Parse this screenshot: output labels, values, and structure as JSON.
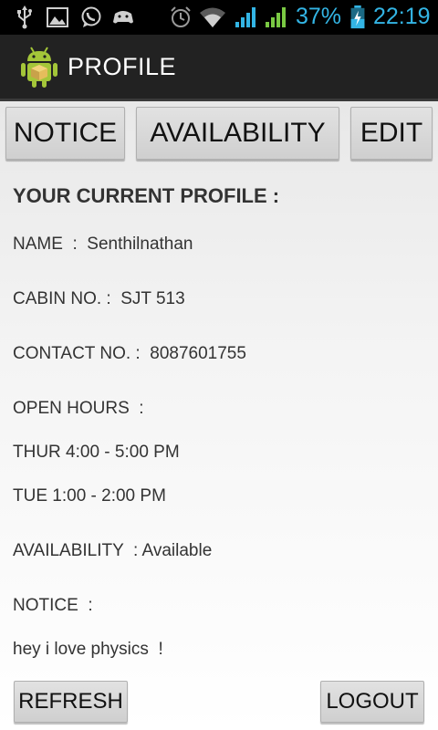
{
  "status_bar": {
    "battery_percent": "37%",
    "time": "22:19",
    "left_icons": [
      "usb-icon",
      "image-icon",
      "whatsapp-icon",
      "gamepad-icon"
    ],
    "right_icons": [
      "alarm-icon",
      "wifi-icon",
      "signal-icon",
      "signal-icon",
      "battery-charging-icon"
    ],
    "accent_color": "#33b5e5"
  },
  "action_bar": {
    "title": "PROFILE",
    "app_icon": "android-icon"
  },
  "top_buttons": {
    "notice": "NOTICE",
    "availability": "AVAILABILITY",
    "edit": "EDIT"
  },
  "profile": {
    "heading": "YOUR CURRENT PROFILE :",
    "name_line": "NAME  :  Senthilnathan",
    "cabin_line": "CABIN NO. :  SJT 513",
    "contact_line": "CONTACT NO. :  8087601755",
    "open_hours_label": "OPEN HOURS  :",
    "hours": [
      "THUR 4:00 - 5:00 PM",
      "TUE 1:00 - 2:00 PM"
    ],
    "availability_line": "AVAILABILITY  : Available",
    "notice_label": "NOTICE  :",
    "notice_text": "hey i love physics  !"
  },
  "bottom_buttons": {
    "refresh": "REFRESH",
    "logout": "LOGOUT"
  }
}
